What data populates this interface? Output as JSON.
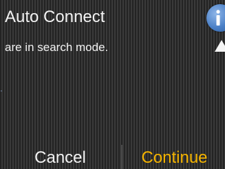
{
  "header": {
    "title": "Auto Connect"
  },
  "message": "are in search mode.",
  "icons": {
    "info": "info-icon",
    "scroll": "scroll-up-arrow-icon"
  },
  "buttons": {
    "cancel": "Cancel",
    "continue": "Continue"
  },
  "colors": {
    "continue_accent": "#f5b400",
    "info_blue": "#4a7fc6",
    "text": "#f2f2f2"
  }
}
